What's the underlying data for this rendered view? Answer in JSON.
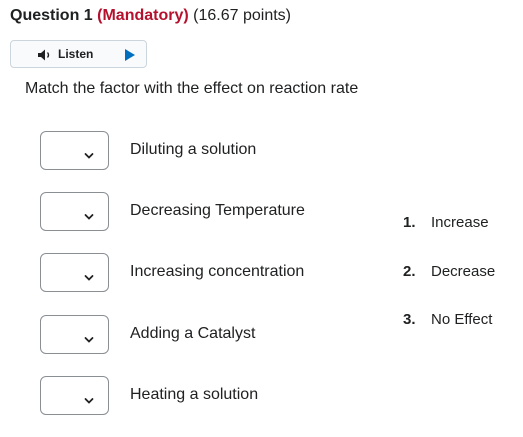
{
  "question": {
    "number_label": "Question 1",
    "mandatory_label": "(Mandatory)",
    "points_label": "(16.67 points)"
  },
  "listen": {
    "label": "Listen"
  },
  "prompt": "Match the factor with the effect on reaction rate",
  "items": [
    {
      "label": "Diluting a solution",
      "selected": ""
    },
    {
      "label": "Decreasing Temperature",
      "selected": ""
    },
    {
      "label": "Increasing concentration",
      "selected": ""
    },
    {
      "label": "Adding a Catalyst",
      "selected": ""
    },
    {
      "label": "Heating a solution",
      "selected": ""
    }
  ],
  "choices": [
    {
      "number": "1.",
      "label": "Increase"
    },
    {
      "number": "2.",
      "label": "Decrease"
    },
    {
      "number": "3.",
      "label": "No Effect"
    }
  ],
  "colors": {
    "mandatory": "#b5112e",
    "text": "#202122",
    "select_border": "#8a8f94",
    "play_icon": "#006fbf"
  }
}
